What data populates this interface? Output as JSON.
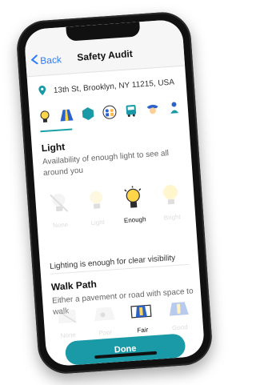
{
  "header": {
    "back_label": "Back",
    "title": "Safety Audit"
  },
  "location": {
    "address": "13th St, Brooklyn, NY 11215, USA"
  },
  "categories": [
    {
      "icon": "lightbulb-icon"
    },
    {
      "icon": "road-icon"
    },
    {
      "icon": "hexagon-icon"
    },
    {
      "icon": "people-icon"
    },
    {
      "icon": "bus-icon"
    },
    {
      "icon": "police-icon"
    },
    {
      "icon": "person-icon"
    }
  ],
  "light": {
    "title": "Light",
    "description": "Availability of enough light to see all around you",
    "options": [
      {
        "label": "None"
      },
      {
        "label": "Light"
      },
      {
        "label": "Enough"
      },
      {
        "label": "Bright"
      }
    ],
    "selected": "Enough",
    "result": "Lighting is enough for clear visibility"
  },
  "walk_path": {
    "title": "Walk Path",
    "description": "Either a pavement or road with space to walk",
    "options": [
      {
        "label": "None"
      },
      {
        "label": "Poor"
      },
      {
        "label": "Fair"
      },
      {
        "label": "Good"
      }
    ],
    "selected": "Fair"
  },
  "actions": {
    "done_label": "Done"
  },
  "colors": {
    "accent": "#1a9aa6",
    "link": "#2b7cff"
  }
}
